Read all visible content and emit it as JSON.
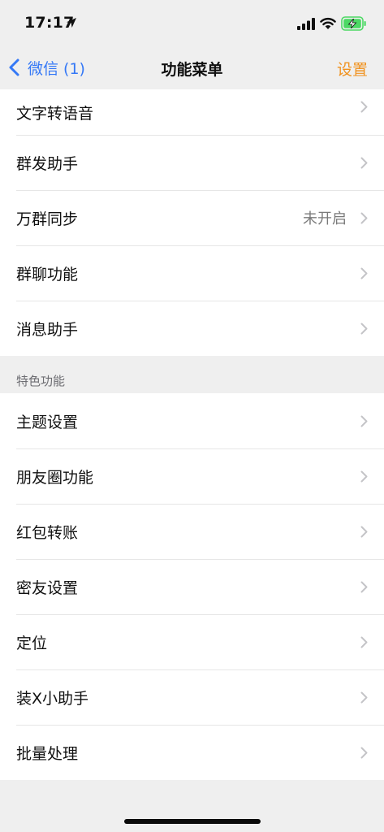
{
  "status_bar": {
    "time": "17:17"
  },
  "nav": {
    "back_label": "微信 (1)",
    "title": "功能菜单",
    "action_label": "设置"
  },
  "group1": {
    "items": [
      {
        "label": "文字转语音",
        "value": ""
      },
      {
        "label": "群发助手",
        "value": ""
      },
      {
        "label": "万群同步",
        "value": "未开启"
      },
      {
        "label": "群聊功能",
        "value": ""
      },
      {
        "label": "消息助手",
        "value": ""
      }
    ]
  },
  "section2": {
    "header": "特色功能",
    "items": [
      {
        "label": "主题设置"
      },
      {
        "label": "朋友圈功能"
      },
      {
        "label": "红包转账"
      },
      {
        "label": "密友设置"
      },
      {
        "label": "定位"
      },
      {
        "label": "装X小助手"
      },
      {
        "label": "批量处理"
      }
    ]
  },
  "colors": {
    "accent_blue": "#3478f6",
    "accent_orange": "#f0921e",
    "battery_green": "#4cd964",
    "background": "#efefef"
  },
  "icons": [
    "location-arrow-icon",
    "signal-icon",
    "wifi-icon",
    "battery-charging-icon",
    "chevron-left-icon",
    "chevron-right-icon"
  ]
}
